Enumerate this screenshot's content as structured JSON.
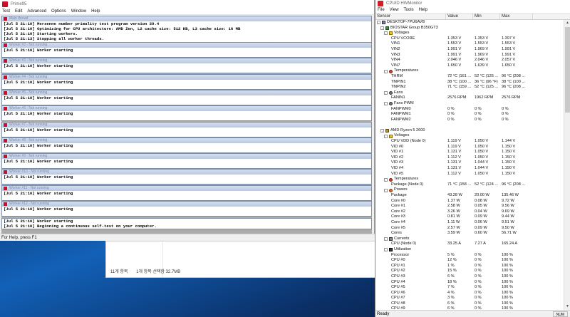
{
  "prime95": {
    "title": "Prime95",
    "menu": [
      "Test",
      "Edit",
      "Advanced",
      "Options",
      "Window",
      "Help"
    ],
    "main_title": "Main thread",
    "main_lines": [
      "[Jul 5 21:10] Mersenne number primality test program version 29.4",
      "[Jul 5 21:10] Optimizing for CPU architecture: AMD Zen, L2 cache size: 512 KB, L3 cache size: 16 MB",
      "[Jul 5 21:10] Starting workers.",
      "[Jul 5 21:13] Stopping all worker threads.",
      "[Jul 5 21:13] Execution halted."
    ],
    "workers": [
      {
        "title": "Worker #2 - Not running",
        "line": "[Jul 5 21:10] Worker starting"
      },
      {
        "title": "Worker #3 - Not running",
        "line": "[Jul 5 21:10] Worker starting"
      },
      {
        "title": "Worker #4 - Not running",
        "line": "[Jul 5 21:10] Worker starting"
      },
      {
        "title": "Worker #5 - Not running",
        "line": "[Jul 5 21:10] Worker starting"
      },
      {
        "title": "Worker #6 - Not running",
        "line": "[Jul 5 21:10] Worker starting"
      },
      {
        "title": "Worker #7 - Not running",
        "line": "[Jul 5 21:10] Worker starting"
      },
      {
        "title": "Worker #8 - Not running",
        "line": "[Jul 5 21:10] Worker starting"
      },
      {
        "title": "Worker #9 - Not running",
        "line": "[Jul 5 21:10] Worker starting"
      },
      {
        "title": "Worker #10 - Not running",
        "line": "[Jul 5 21:10] Worker starting"
      },
      {
        "title": "Worker #11 - Not running",
        "line": "[Jul 5 21:10] Worker starting"
      },
      {
        "title": "Worker #12 - Not running",
        "line": "[Jul 5 21:10] Worker starting"
      }
    ],
    "last_worker_lines": [
      "[Jul 5 21:10] Worker starting",
      "[Jul 5 21:10] Beginning a continuous self-test on your computer."
    ],
    "status": "For Help, press F1"
  },
  "explorer": {
    "items_count": "11개 항목",
    "selection": "1개 항목 선택함 32.7MB"
  },
  "hwmonitor": {
    "title": "CPUID HWMonitor",
    "menu": [
      "File",
      "View",
      "Tools",
      "Help"
    ],
    "columns": {
      "sensor": "Sensor",
      "value": "Value",
      "min": "Min",
      "max": "Max"
    },
    "rows": [
      {
        "indent": 0,
        "icon": "pc",
        "exp": "-",
        "name": "DESKTOP-7PU6AVB"
      },
      {
        "indent": 1,
        "icon": "board",
        "exp": "-",
        "name": "BIOSTAR Group B350GT3"
      },
      {
        "indent": 2,
        "icon": "volt",
        "exp": "-",
        "name": "Voltages"
      },
      {
        "indent": 4,
        "name": "CPU VCORE",
        "v": "1.353 V",
        "mn": "1.353 V",
        "mx": "1.397 V"
      },
      {
        "indent": 4,
        "name": "VIN1",
        "v": "1.553 V",
        "mn": "1.553 V",
        "mx": "1.553 V"
      },
      {
        "indent": 4,
        "name": "VIN2",
        "v": "1.991 V",
        "mn": "1.969 V",
        "mx": "1.991 V"
      },
      {
        "indent": 4,
        "name": "VIN3",
        "v": "1.991 V",
        "mn": "1.969 V",
        "mx": "1.991 V"
      },
      {
        "indent": 4,
        "name": "VIN4",
        "v": "2.046 V",
        "mn": "2.046 V",
        "mx": "2.057 V"
      },
      {
        "indent": 4,
        "name": "VIN7",
        "v": "1.650 V",
        "mn": "1.639 V",
        "mx": "1.650 V"
      },
      {
        "indent": 2,
        "icon": "temp",
        "exp": "-",
        "name": "Temperatures"
      },
      {
        "indent": 4,
        "name": "THRM",
        "v": "72 °C  (161 ...",
        "mn": "52 °C  (125 ...",
        "mx": "96 °C  (208 ..."
      },
      {
        "indent": 4,
        "name": "TMPIN1",
        "v": "38 °C  (100 ...",
        "mn": "36 °C  (96 °F)",
        "mx": "38 °C  (100 ..."
      },
      {
        "indent": 4,
        "name": "TMPIN2",
        "v": "71 °C  (159 ...",
        "mn": "52 °C  (125 ...",
        "mx": "96 °C  (208 ..."
      },
      {
        "indent": 2,
        "icon": "fan",
        "exp": "-",
        "name": "Fans"
      },
      {
        "indent": 4,
        "name": "FANIN1",
        "v": "2576 RPM",
        "mn": "1962 RPM",
        "mx": "2576 RPM"
      },
      {
        "indent": 2,
        "icon": "fan",
        "exp": "-",
        "name": "Fans PWM"
      },
      {
        "indent": 4,
        "name": "FANPWM0",
        "v": "0 %",
        "mn": "0 %",
        "mx": "0 %"
      },
      {
        "indent": 4,
        "name": "FANPWM1",
        "v": "0 %",
        "mn": "0 %",
        "mx": "0 %"
      },
      {
        "indent": 4,
        "name": "FANPWM2",
        "v": "0 %",
        "mn": "0 %",
        "mx": "0 %"
      },
      {
        "indent": 0,
        "name": ""
      },
      {
        "indent": 1,
        "icon": "cpu",
        "exp": "-",
        "name": "AMD Ryzen 5 2600"
      },
      {
        "indent": 2,
        "icon": "volt",
        "exp": "-",
        "name": "Voltages"
      },
      {
        "indent": 4,
        "name": "CPU VDD (Node 0)",
        "v": "1.119 V",
        "mn": "1.050 V",
        "mx": "1.144 V"
      },
      {
        "indent": 4,
        "name": "VID #0",
        "v": "1.119 V",
        "mn": "1.050 V",
        "mx": "1.150 V"
      },
      {
        "indent": 4,
        "name": "VID #1",
        "v": "1.131 V",
        "mn": "1.050 V",
        "mx": "1.150 V"
      },
      {
        "indent": 4,
        "name": "VID #2",
        "v": "1.112 V",
        "mn": "1.050 V",
        "mx": "1.150 V"
      },
      {
        "indent": 4,
        "name": "VID #3",
        "v": "1.131 V",
        "mn": "1.044 V",
        "mx": "1.150 V"
      },
      {
        "indent": 4,
        "name": "VID #4",
        "v": "1.131 V",
        "mn": "1.044 V",
        "mx": "1.150 V"
      },
      {
        "indent": 4,
        "name": "VID #5",
        "v": "1.112 V",
        "mn": "1.050 V",
        "mx": "1.150 V"
      },
      {
        "indent": 2,
        "icon": "temp",
        "exp": "-",
        "name": "Temperatures"
      },
      {
        "indent": 4,
        "name": "Package (Node 0)",
        "v": "71 °C  (158 ...",
        "mn": "52 °C  (124 ...",
        "mx": "96 °C  (208 ..."
      },
      {
        "indent": 2,
        "icon": "power",
        "exp": "-",
        "name": "Powers"
      },
      {
        "indent": 4,
        "name": "Package",
        "v": "43.28 W",
        "mn": "20.00 W",
        "mx": "135.46 W"
      },
      {
        "indent": 4,
        "name": "Core #0",
        "v": "1.37 W",
        "mn": "0.08 W",
        "mx": "9.72 W"
      },
      {
        "indent": 4,
        "name": "Core #1",
        "v": "2.58 W",
        "mn": "0.05 W",
        "mx": "9.56 W"
      },
      {
        "indent": 4,
        "name": "Core #2",
        "v": "3.26 W",
        "mn": "0.04 W",
        "mx": "9.69 W"
      },
      {
        "indent": 4,
        "name": "Core #3",
        "v": "0.81 W",
        "mn": "0.09 W",
        "mx": "9.44 W"
      },
      {
        "indent": 4,
        "name": "Core #4",
        "v": "1.11 W",
        "mn": "0.06 W",
        "mx": "9.51 W"
      },
      {
        "indent": 4,
        "name": "Core #5",
        "v": "2.57 W",
        "mn": "0.09 W",
        "mx": "9.50 W"
      },
      {
        "indent": 4,
        "name": "Cores",
        "v": "3.59 W",
        "mn": "0.60 W",
        "mx": "56.71 W"
      },
      {
        "indent": 2,
        "icon": "curr",
        "exp": "-",
        "name": "Currents"
      },
      {
        "indent": 4,
        "name": "CPU (Node 0)",
        "v": "33.25 A",
        "mn": "7.27 A",
        "mx": "165.24 A"
      },
      {
        "indent": 2,
        "icon": "util",
        "exp": "-",
        "name": "Utilization"
      },
      {
        "indent": 4,
        "name": "Processor",
        "v": "5 %",
        "mn": "0 %",
        "mx": "100 %"
      },
      {
        "indent": 4,
        "name": "CPU #0",
        "v": "12 %",
        "mn": "0 %",
        "mx": "100 %"
      },
      {
        "indent": 4,
        "name": "CPU #1",
        "v": "1 %",
        "mn": "0 %",
        "mx": "100 %"
      },
      {
        "indent": 4,
        "name": "CPU #2",
        "v": "15 %",
        "mn": "0 %",
        "mx": "100 %"
      },
      {
        "indent": 4,
        "name": "CPU #3",
        "v": "6 %",
        "mn": "0 %",
        "mx": "100 %"
      },
      {
        "indent": 4,
        "name": "CPU #4",
        "v": "18 %",
        "mn": "0 %",
        "mx": "100 %"
      },
      {
        "indent": 4,
        "name": "CPU #5",
        "v": "7 %",
        "mn": "0 %",
        "mx": "100 %"
      },
      {
        "indent": 4,
        "name": "CPU #6",
        "v": "4 %",
        "mn": "0 %",
        "mx": "100 %"
      },
      {
        "indent": 4,
        "name": "CPU #7",
        "v": "3 %",
        "mn": "0 %",
        "mx": "100 %"
      },
      {
        "indent": 4,
        "name": "CPU #8",
        "v": "6 %",
        "mn": "0 %",
        "mx": "100 %"
      },
      {
        "indent": 4,
        "name": "CPU #9",
        "v": "6 %",
        "mn": "0 %",
        "mx": "100 %"
      }
    ],
    "status": "Ready",
    "num_indicator": "NUM"
  }
}
